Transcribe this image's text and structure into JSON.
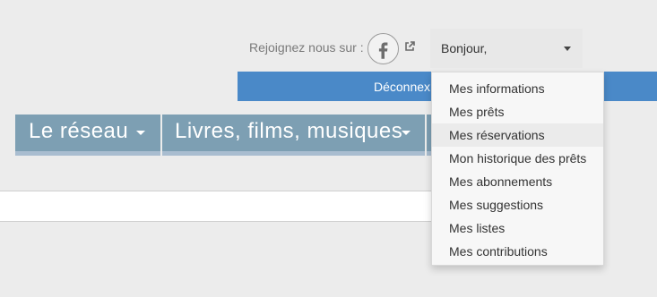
{
  "header": {
    "social_label": "Rejoignez nous sur :",
    "social_icon": "facebook-icon",
    "external_link_icon": "external-link-icon",
    "greeting": "Bonjour,"
  },
  "logout": {
    "label": "Déconnex"
  },
  "nav": {
    "items": [
      {
        "label": "Le réseau"
      },
      {
        "label": "Livres, films, musiques"
      }
    ]
  },
  "user_menu": {
    "items": [
      {
        "label": "Mes informations"
      },
      {
        "label": "Mes prêts"
      },
      {
        "label": "Mes réservations"
      },
      {
        "label": "Mon historique des prêts"
      },
      {
        "label": "Mes abonnements"
      },
      {
        "label": "Mes suggestions"
      },
      {
        "label": "Mes listes"
      },
      {
        "label": "Mes contributions"
      }
    ],
    "hovered_item": "Mes réservations"
  },
  "colors": {
    "background": "#ececec",
    "nav_bar": "#7d9fb3",
    "logout_bar": "#4a89c8",
    "dropdown": "#f7f7f7"
  }
}
